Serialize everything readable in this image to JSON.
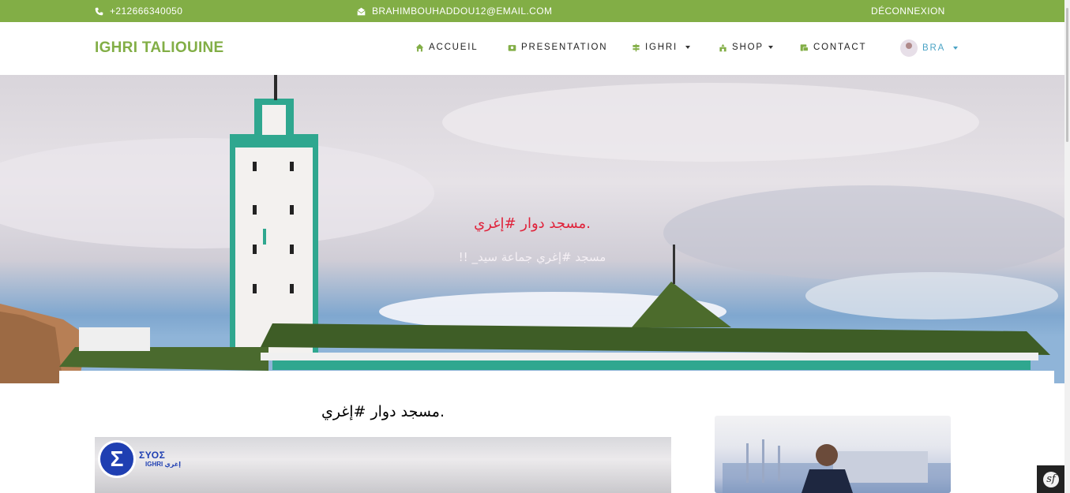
{
  "topbar": {
    "phone": "+212666340050",
    "email": "BRAHIMBOUHADDOU12@EMAIL.COM",
    "logout": "DÉCONNEXION",
    "phone_icon": "phone-icon",
    "email_icon": "envelope-icon"
  },
  "navbar": {
    "brand": "IGHRI TALIOUINE",
    "items": [
      {
        "label": "ACCUEIL",
        "icon": "home-icon"
      },
      {
        "label": "PRESENTATION",
        "icon": "id-card-icon"
      },
      {
        "label": "IGHRI",
        "icon": "signpost-icon"
      },
      {
        "label": "SHOP",
        "icon": "store-icon"
      },
      {
        "label": "CONTACT",
        "icon": "contact-card-icon"
      }
    ],
    "user": {
      "label": "BRA",
      "icon": "avatar"
    }
  },
  "hero": {
    "title": "مسجد دوار #إغري.",
    "subtitle": "!! _مسجد #إغري جماعة سيد"
  },
  "main": {
    "post_title": "مسجد دوار #إغري.",
    "logo_text": "ΣΥΟΣ",
    "logo_subtext": "IGHRI إغري"
  },
  "sf_toolbar": {
    "label": "sf"
  },
  "colors": {
    "brand": "#82ae46",
    "hero_title": "#e0223a",
    "text": "#222222"
  }
}
